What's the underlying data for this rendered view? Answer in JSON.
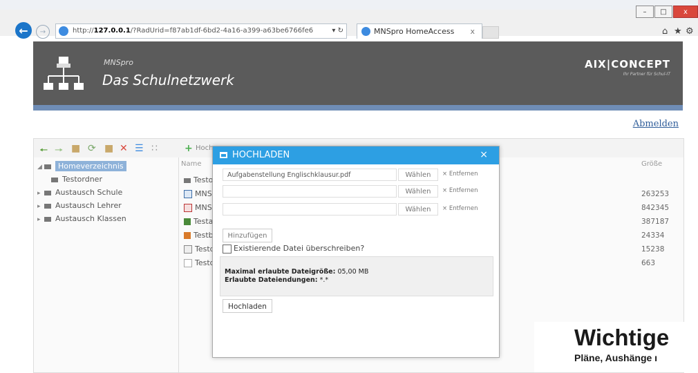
{
  "browser": {
    "url_prefix": "http://",
    "url_host": "127.0.0.1",
    "url_path": "/?RadUrid=f87ab1df-6bd2-4a16-a399-a63be6766fe6",
    "address_tools": "▾ ↻",
    "tab_title": "MNSpro HomeAccess",
    "tab_close": "x",
    "win_minimize": "–",
    "win_maximize": "□",
    "win_close": "x",
    "icons_right": [
      "home-icon",
      "star-icon",
      "gear-icon"
    ]
  },
  "header": {
    "product_small": "MNSpro",
    "product_big": "Das Schulnetzwerk",
    "partner_logo": "AIX|CONCEPT",
    "partner_tagline": "Ihr Partner für Schul-IT",
    "logout": "Abmelden"
  },
  "toolbar": {
    "upload_label": "Hoch"
  },
  "tree": [
    {
      "label": "Homeverzeichnis",
      "selected": true,
      "arrow": "◢"
    },
    {
      "label": "Testordner",
      "selected": false,
      "arrow": ""
    },
    {
      "label": "Austausch Schule",
      "selected": false,
      "arrow": "▸"
    },
    {
      "label": "Austausch Lehrer",
      "selected": false,
      "arrow": "▸"
    },
    {
      "label": "Austausch Klassen",
      "selected": false,
      "arrow": "▸"
    }
  ],
  "list": {
    "col_name": "Name",
    "col_size": "Größe",
    "rows": [
      {
        "name": "Testo",
        "size": ""
      },
      {
        "name": "MNS",
        "size": "263253"
      },
      {
        "name": "MNS",
        "size": "842345"
      },
      {
        "name": "Testa",
        "size": "387187"
      },
      {
        "name": "Testb",
        "size": "24334"
      },
      {
        "name": "Testd",
        "size": "15238"
      },
      {
        "name": "Testd",
        "size": "663"
      }
    ]
  },
  "modal": {
    "title": "HOCHLADEN",
    "close": "×",
    "files": [
      {
        "value": "Aufgabenstellung Englischklausur.pdf",
        "choose": "Wählen",
        "remove": "× Entfernen"
      },
      {
        "value": "",
        "choose": "Wählen",
        "remove": "× Entfernen"
      },
      {
        "value": "",
        "choose": "Wählen",
        "remove": "× Entfernen"
      }
    ],
    "add_label": "Hinzufügen",
    "overwrite_label": "Existierende Datei überschreiben?",
    "max_size_label": "Maximal erlaubte Dateigröße:",
    "max_size_value": "05,00 MB",
    "extensions_label": "Erlaubte Dateiendungen:",
    "extensions_value": "*.*",
    "upload_label": "Hochladen"
  },
  "overlay": {
    "headline": "Wichtige",
    "subline": "Pläne, Aushänge ı"
  }
}
